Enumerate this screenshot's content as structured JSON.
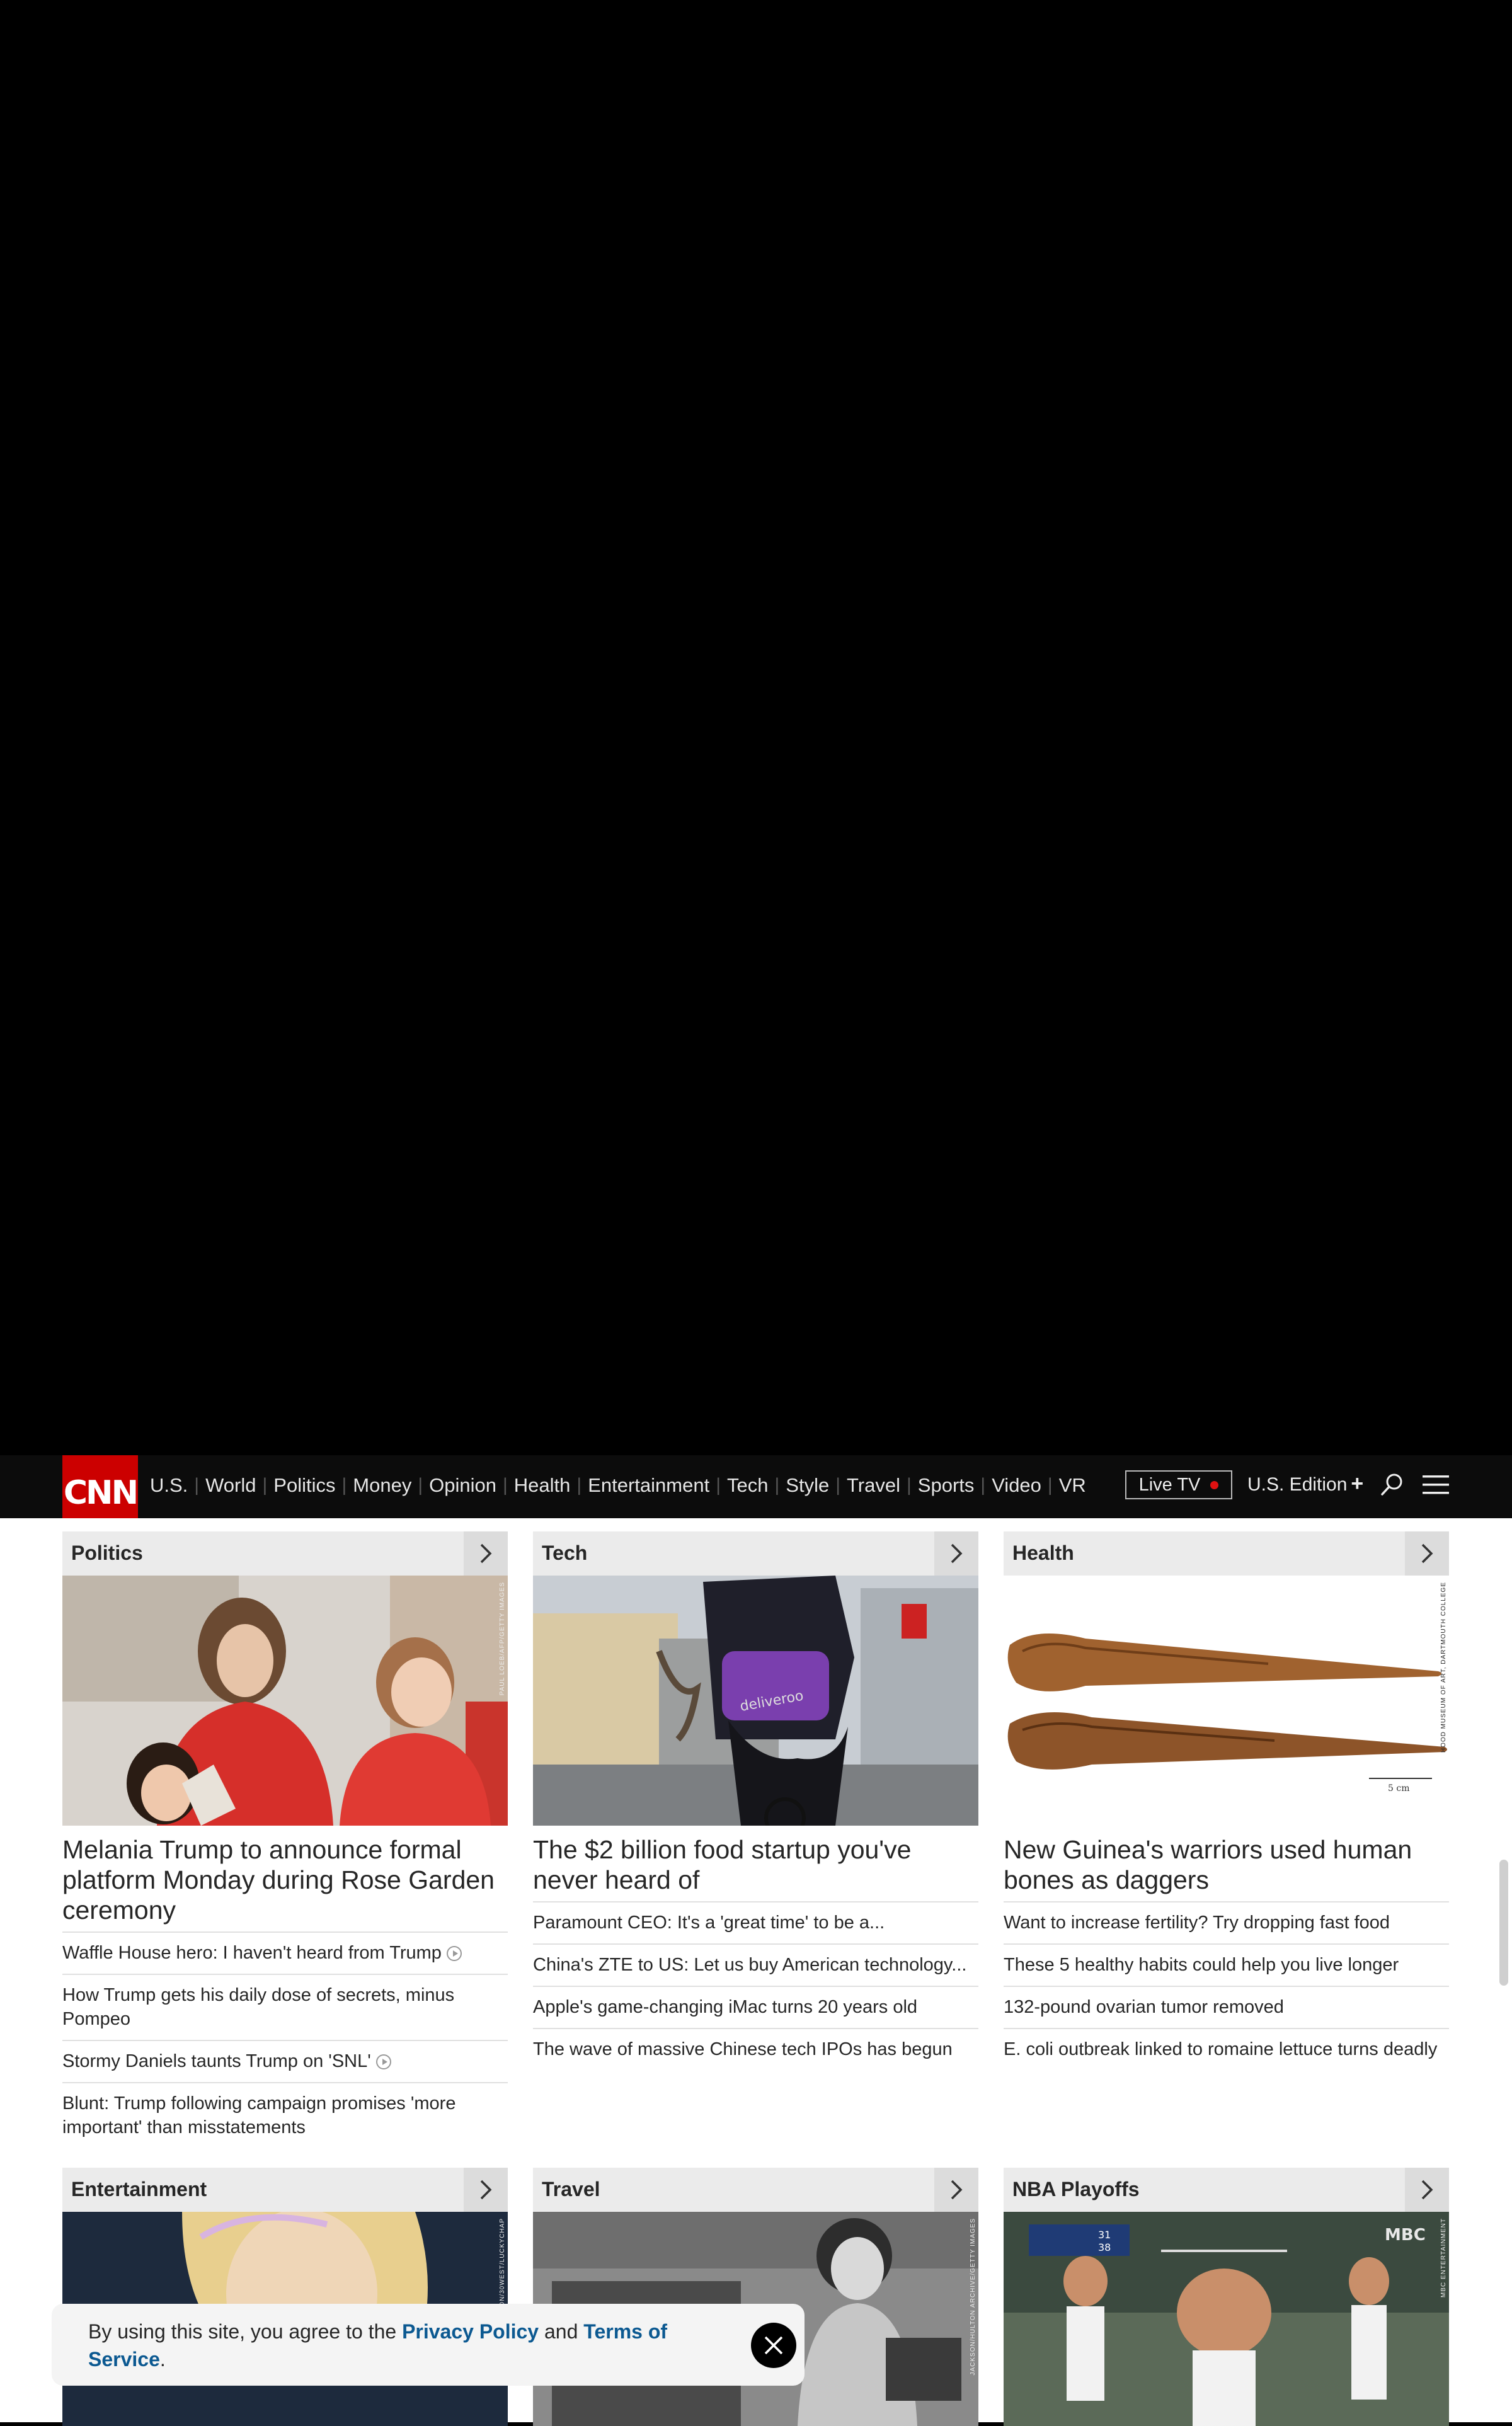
{
  "brand": {
    "logo_text": "CNN",
    "accent": "#cc0000"
  },
  "nav": {
    "items": [
      "U.S.",
      "World",
      "Politics",
      "Money",
      "Opinion",
      "Health",
      "Entertainment",
      "Tech",
      "Style",
      "Travel",
      "Sports",
      "Video",
      "VR"
    ],
    "live_tv": "Live TV",
    "edition": "U.S. Edition",
    "edition_plus": "+",
    "search_icon": "search-icon",
    "menu_icon": "hamburger-menu-icon"
  },
  "sections": [
    {
      "title": "Politics",
      "image_credit": "PAUL LOEB/AFP/GETTY IMAGES",
      "headline": "Melania Trump to announce formal platform Monday during Rose Garden ceremony",
      "links": [
        {
          "text": "Waffle House hero: I haven't heard from Trump",
          "video": true
        },
        {
          "text": "How Trump gets his daily dose of secrets, minus Pompeo",
          "video": false
        },
        {
          "text": "Stormy Daniels taunts Trump on 'SNL'",
          "video": true
        },
        {
          "text": "Blunt: Trump following campaign promises 'more important' than misstatements",
          "video": false
        }
      ]
    },
    {
      "title": "Tech",
      "image_credit": "",
      "headline": "The $2 billion food startup you've never heard of",
      "links": [
        {
          "text": "Paramount CEO: It's a 'great time' to be a...",
          "video": false
        },
        {
          "text": "China's ZTE to US: Let us buy American technology...",
          "video": false
        },
        {
          "text": "Apple's game-changing iMac turns 20 years old",
          "video": false
        },
        {
          "text": "The wave of massive Chinese tech IPOs has begun",
          "video": false
        }
      ]
    },
    {
      "title": "Health",
      "image_credit": "HOOD MUSEUM OF ART, DARTMOUTH COLLEGE",
      "image_scale_label": "5 cm",
      "headline": "New Guinea's warriors used human bones as daggers",
      "links": [
        {
          "text": "Want to increase fertility? Try dropping fast food",
          "video": false
        },
        {
          "text": "These 5 healthy habits could help you live longer",
          "video": false
        },
        {
          "text": "132-pound ovarian tumor removed",
          "video": false
        },
        {
          "text": "E. coli outbreak linked to romaine lettuce turns deadly",
          "video": false
        }
      ]
    },
    {
      "title": "Entertainment",
      "image_credit": "NEON/30WEST/LUCKYCHAP"
    },
    {
      "title": "Travel",
      "image_credit": "JACKSON/HULTON ARCHIVE/GETTY IMAGES"
    },
    {
      "title": "NBA Playoffs",
      "image_credit": "MBC ENTERTAINMENT",
      "image_logo": "MBC",
      "score_home": "31",
      "score_away": "38"
    }
  ],
  "cookie_banner": {
    "prefix": "By using this site, you agree to the ",
    "privacy_link": "Privacy Policy",
    "middle": " and ",
    "terms_link": "Terms of Service",
    "suffix": "."
  }
}
